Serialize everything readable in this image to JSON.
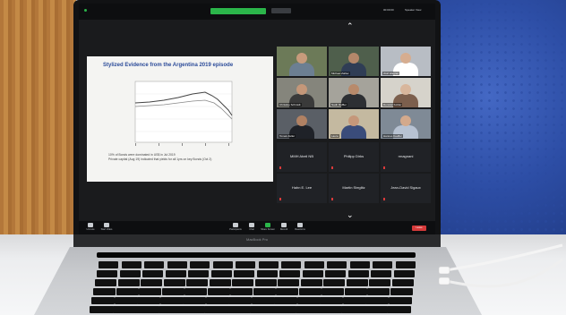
{
  "meeting": {
    "notice_bar": "",
    "speaker_view_label": "Speaker View",
    "time_label": "00:00:00"
  },
  "slide": {
    "title": "Stylized Evidence from the Argentina 2019 episode",
    "bullets": [
      "10% of Bonds were dominated in US$ in Jul 2019",
      "Private capital (Aug 19) indicated that yields for all 1yrs on key Bonds (Oct 2)"
    ]
  },
  "participants_video": [
    {
      "name": "",
      "skin": "#c79b7c",
      "shirt": "#6c7f92",
      "bg": "#6c7a58"
    },
    {
      "name": "Michael Zahler",
      "skin": "#b4876a",
      "shirt": "#2f3d55",
      "bg": "#4f5f4c"
    },
    {
      "name": "Wolf Wagner",
      "skin": "#d6ad90",
      "shirt": "#ffffff",
      "bg": "#b8bdc4"
    },
    {
      "name": "Christine Schmidt",
      "skin": "#c49779",
      "shirt": "#3a3a3a",
      "bg": "#85857c"
    },
    {
      "name": "Nadir Ruffler",
      "skin": "#b88a6b",
      "shirt": "#2d2f33",
      "bg": "#a5a39b"
    },
    {
      "name": "Dominic Kohler",
      "skin": "#d8b69c",
      "shirt": "#7c5f4d",
      "bg": "#d6d3cb"
    },
    {
      "name": "Tomek Zeller",
      "skin": "#b08163",
      "shirt": "#1f2228",
      "bg": "#5a5f66"
    },
    {
      "name": "Laura",
      "skin": "#c5977a",
      "shirt": "#3a4c7a",
      "bg": "#c4b9a0"
    },
    {
      "name": "Hannes Kauffer",
      "skin": "#d3a98c",
      "shirt": "#b7c2d2",
      "bg": "#7f8a96"
    }
  ],
  "participants_names": [
    "MMH Abeil NB",
    "Philipp Dirks",
    "rmagnani",
    "Hahn E. Lee",
    "Martin Steglitz",
    "Jean-David Sigaux"
  ],
  "toolbar": {
    "items": [
      "Unmute",
      "Start Video",
      "Participants",
      "Chat",
      "Share Screen",
      "Record",
      "Reactions"
    ],
    "leave": "Leave"
  },
  "laptop_brand": "MacBook Pro",
  "colors": {
    "share_green": "#2bb54a",
    "leave_red": "#d63a3a",
    "slide_title": "#2b4b99"
  }
}
